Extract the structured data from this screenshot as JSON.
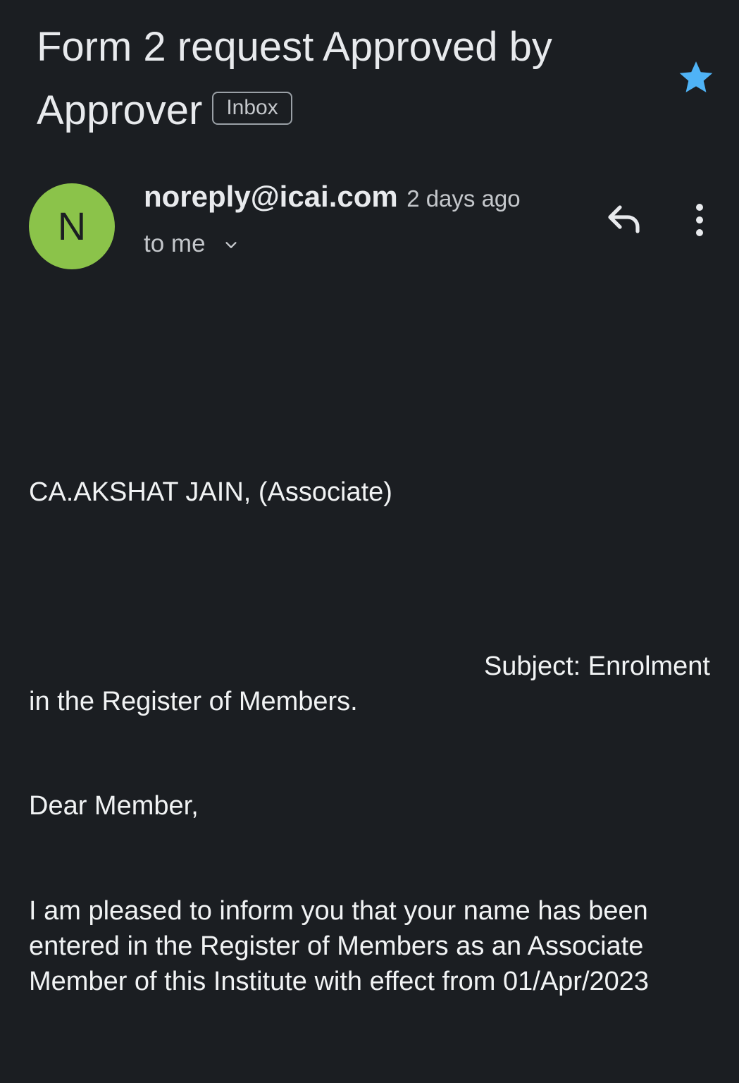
{
  "email": {
    "subject": "Form 2 request Approved by Approver",
    "label_badge": "Inbox",
    "starred": true,
    "star_color": "#4fb3f6"
  },
  "sender": {
    "avatar_letter": "N",
    "avatar_color": "#8bc34a",
    "address": "noreply@icai.com",
    "time": "2 days ago",
    "recipient": "to me"
  },
  "actions": {
    "reply_icon": "reply-icon",
    "more_icon": "more-vert-icon"
  },
  "body": {
    "addressee": "CA.AKSHAT JAIN, (Associate)",
    "subject_line_part1": "Subject: Enrolment",
    "subject_line_part2": "in the Register of Members.",
    "salutation": "Dear Member,",
    "paragraph": "I am pleased to inform you that your name has been entered in the Register of Members as an Associate Member of this Institute with effect from 01/Apr/2023"
  }
}
